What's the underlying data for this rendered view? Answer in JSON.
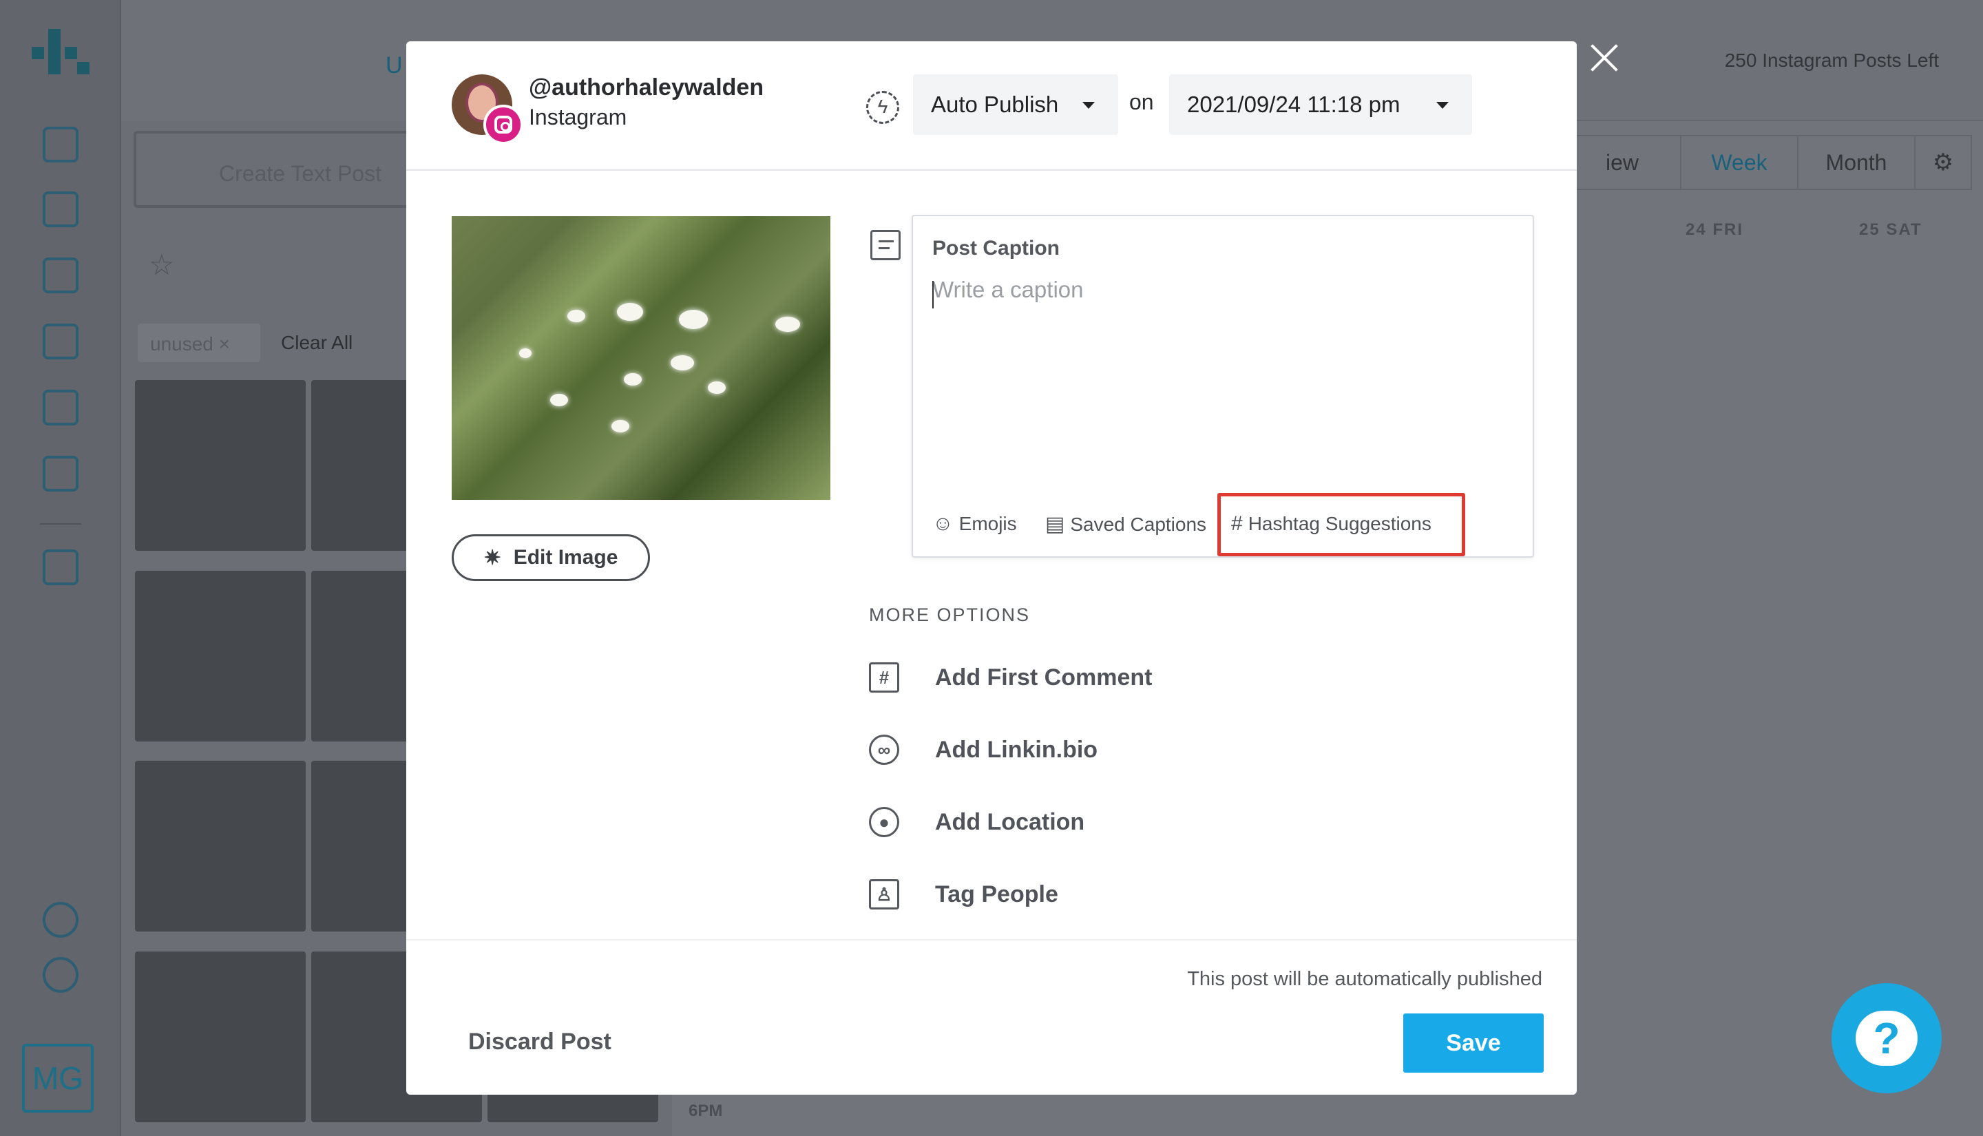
{
  "background": {
    "create_text_post": "Create Text Post",
    "filter_tag": "unused",
    "clear_all": "Clear All",
    "posts_left": "250 Instagram Posts Left",
    "view_tabs": [
      "iew",
      "Week",
      "Month"
    ],
    "days": [
      "24 FRI",
      "25 SAT"
    ],
    "time": "6PM",
    "account_initials": "MG",
    "partial_upload_label": "U"
  },
  "modal": {
    "account": {
      "handle": "@authorhaleywalden",
      "network": "Instagram"
    },
    "publish_mode": "Auto Publish",
    "on_label": "on",
    "scheduled_time": "2021/09/24 11:18 pm",
    "edit_image_label": "Edit Image",
    "caption": {
      "label": "Post Caption",
      "placeholder": "Write a caption",
      "value": "",
      "tools": [
        "Emojis",
        "Saved Captions",
        "Hashtag Suggestions"
      ]
    },
    "more_options_label": "MORE OPTIONS",
    "more_options": [
      "Add First Comment",
      "Add Linkin.bio",
      "Add Location",
      "Tag People"
    ],
    "publish_notice": "This post will be automatically published",
    "discard_label": "Discard Post",
    "save_label": "Save"
  },
  "colors": {
    "overlay": "#6e7178",
    "save_button": "#18a9e8",
    "instagram_badge": "#d71f86",
    "highlight": "#de3a32",
    "help_button": "#1aa8e1"
  },
  "icons": {
    "close": "close-icon",
    "help": "help-icon",
    "instagram": "instagram-icon",
    "auto_publish": "auto-publish-icon",
    "caption": "caption-icon"
  }
}
